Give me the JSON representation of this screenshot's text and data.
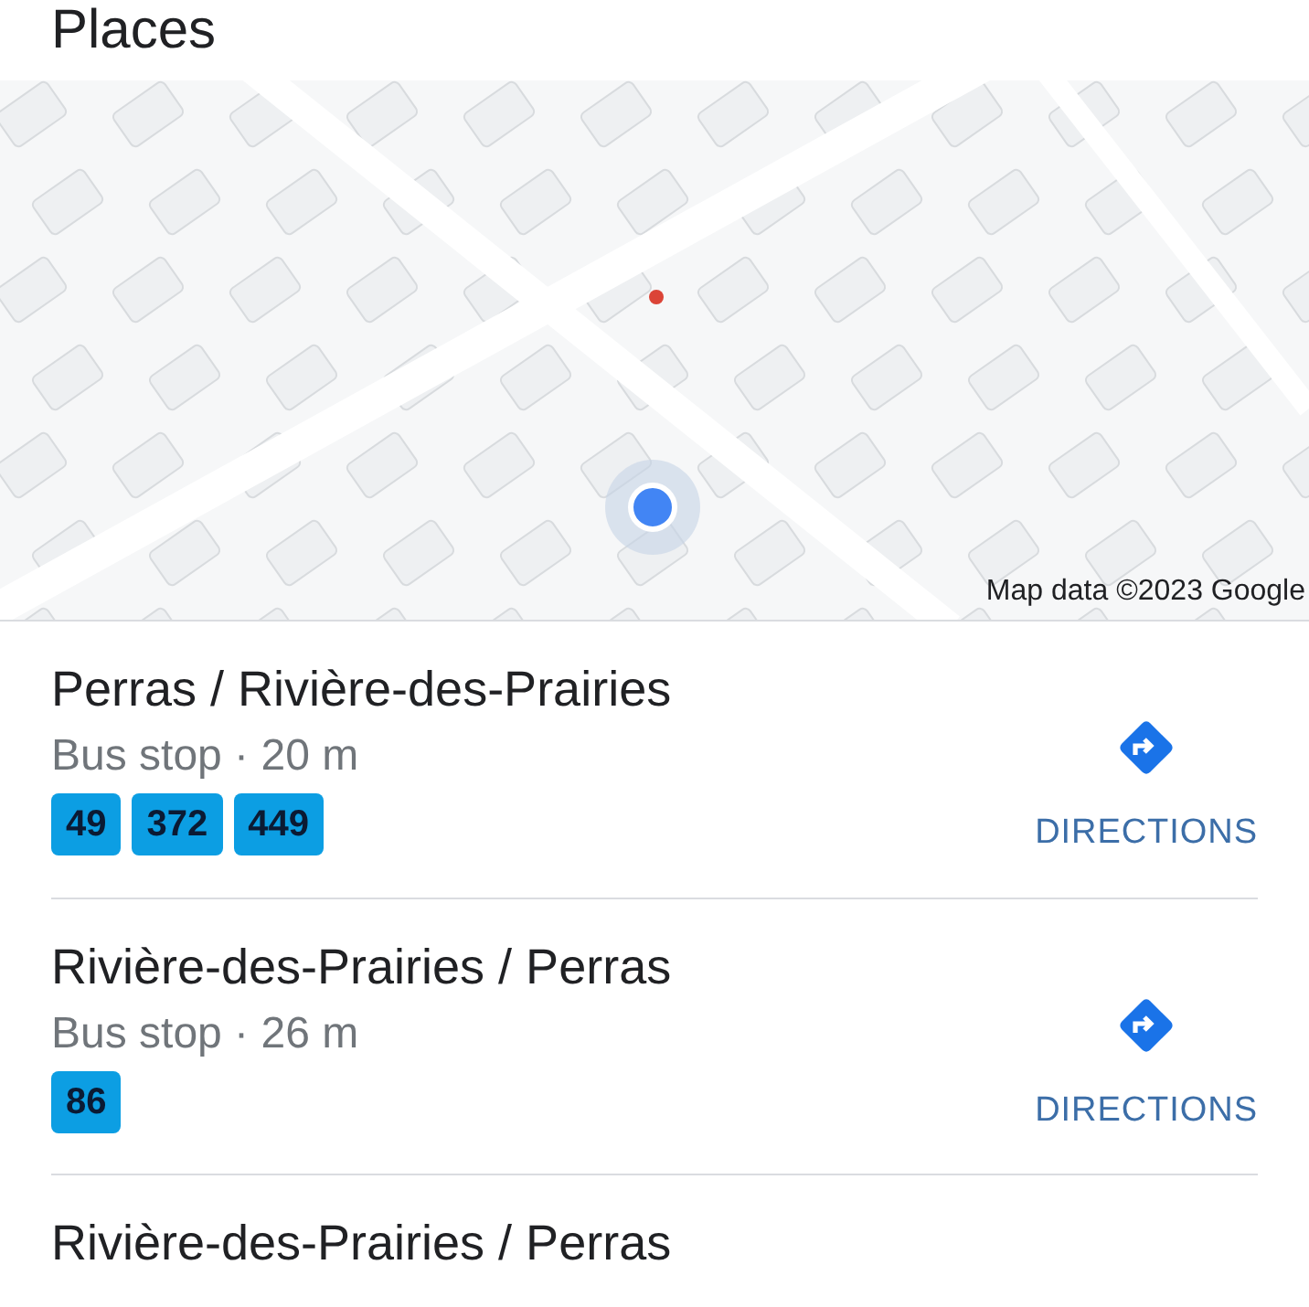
{
  "header": {
    "title": "Places"
  },
  "map": {
    "kind": "picture",
    "attribution": "Map data ©2023 Google"
  },
  "places": [
    {
      "name": "Perras / Rivière-des-Prairies",
      "detail": "Bus stop · 20 m",
      "routes": [
        "49",
        "372",
        "449"
      ],
      "action": "DIRECTIONS"
    },
    {
      "name": "Rivière-des-Prairies / Perras",
      "detail": "Bus stop · 26 m",
      "routes": [
        "86"
      ],
      "action": "DIRECTIONS"
    },
    {
      "name": "Rivière-des-Prairies / Perras"
    }
  ]
}
